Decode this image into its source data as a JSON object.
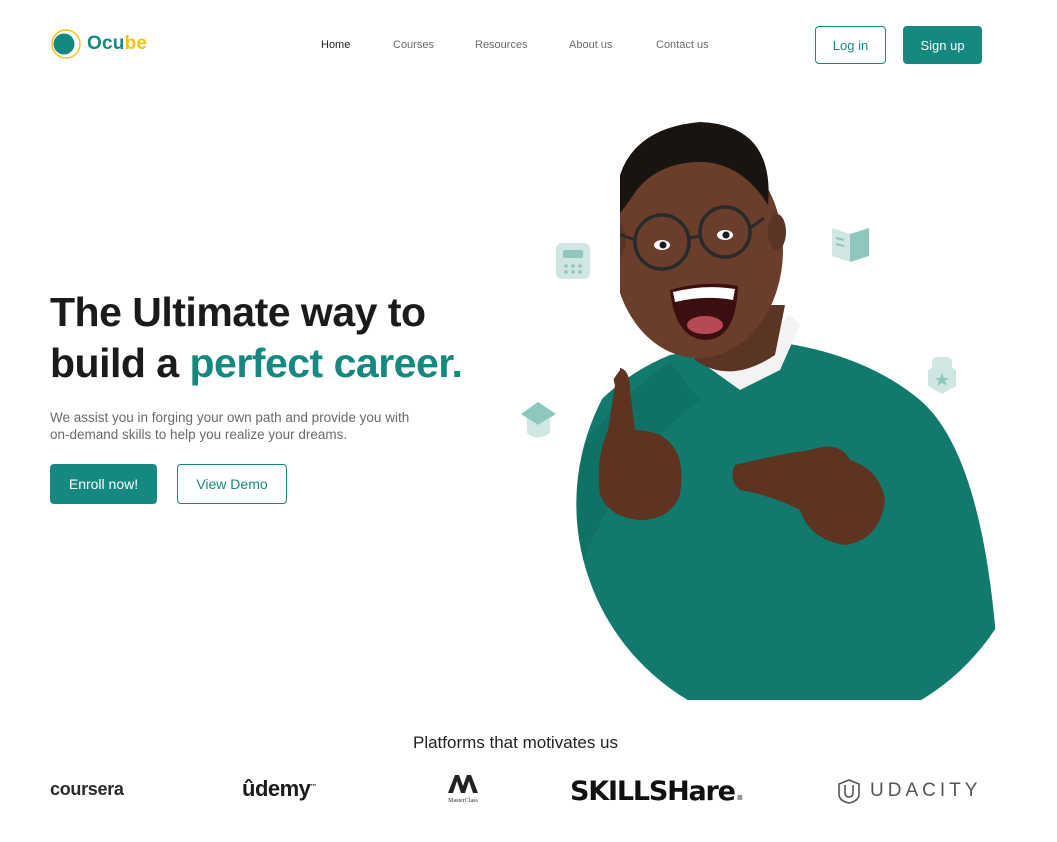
{
  "brand": {
    "name_part1": "Ocu",
    "name_part2": "be",
    "primary": "#15887f",
    "accent": "#f2c316"
  },
  "nav": {
    "items": [
      "Home",
      "Courses",
      "Resources",
      "About us",
      "Contact us"
    ],
    "active": "Home"
  },
  "auth": {
    "login": "Log in",
    "signup": "Sign up"
  },
  "hero": {
    "title_line1": "The Ultimate way to",
    "title_line2_prefix": "build a ",
    "title_line2_accent": "perfect career.",
    "subtitle": "We assist you in forging your own path and provide you with on-demand skills to help you realize your dreams.",
    "cta_primary": "Enroll now!",
    "cta_secondary": "View Demo"
  },
  "floating_icons": [
    "calculator-icon",
    "book-icon",
    "graduation-cap-icon",
    "badge-lock-icon"
  ],
  "platforms": {
    "title": "Platforms that motivates us",
    "coursera": "coursera",
    "udemy": "ûdemy",
    "udemy_tm": "™",
    "masterclass": "MasterClass",
    "skillshare": "SKILLSHare",
    "skillshare_dot": ".",
    "udacity": "UDACITY"
  }
}
